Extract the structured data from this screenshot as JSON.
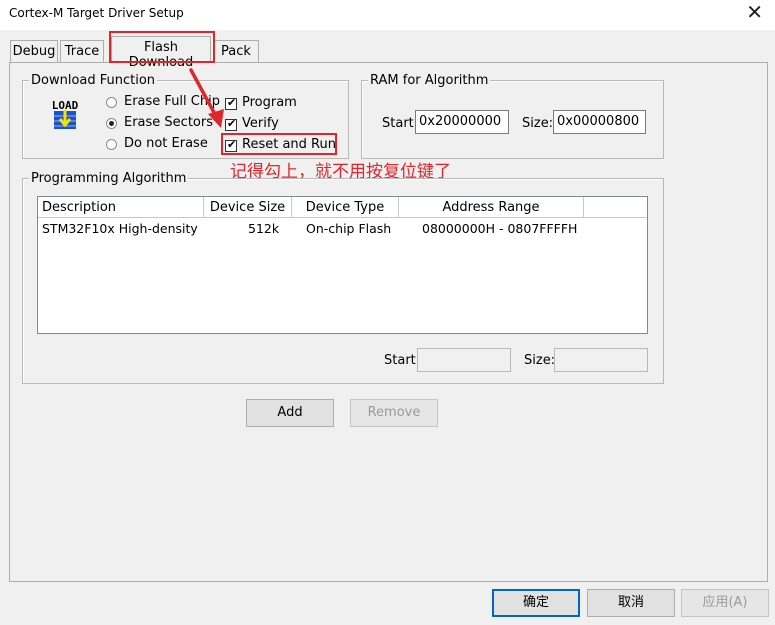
{
  "window": {
    "title": "Cortex-M Target Driver Setup",
    "close_glyph": "✕"
  },
  "tabs": [
    {
      "label": "Debug"
    },
    {
      "label": "Trace"
    },
    {
      "label": "Flash Download"
    },
    {
      "label": "Pack"
    }
  ],
  "download_function": {
    "legend": "Download Function",
    "icon_text": "LOAD",
    "radios": [
      {
        "label": "Erase Full Chip",
        "selected": false
      },
      {
        "label": "Erase Sectors",
        "selected": true
      },
      {
        "label": "Do not Erase",
        "selected": false
      }
    ],
    "checks": [
      {
        "label": "Program",
        "checked": true
      },
      {
        "label": "Verify",
        "checked": true
      },
      {
        "label": "Reset and Run",
        "checked": true
      }
    ],
    "tick_glyph": "✔"
  },
  "annotation": {
    "text": "记得勾上，就不用按复位键了",
    "color": "#e0262c"
  },
  "ram": {
    "legend": "RAM for Algorithm",
    "start_label": "Start:",
    "start_value": "0x20000000",
    "size_label": "Size:",
    "size_value": "0x00000800"
  },
  "programming_algorithm": {
    "legend": "Programming Algorithm",
    "columns": [
      "Description",
      "Device Size",
      "Device Type",
      "Address Range"
    ],
    "rows": [
      {
        "description": "STM32F10x High-density ...",
        "size": "512k",
        "type": "On-chip Flash",
        "range": "08000000H - 0807FFFFH"
      }
    ],
    "start_label": "Start:",
    "start_value": "",
    "size_label": "Size:",
    "size_value": ""
  },
  "buttons": {
    "add": "Add",
    "remove": "Remove",
    "ok": "确定",
    "cancel": "取消",
    "apply": "应用(A)"
  },
  "colors": {
    "highlight": "#e0262c",
    "default_button_border": "#0067c0",
    "icon_arrow": "#1a52c8"
  }
}
